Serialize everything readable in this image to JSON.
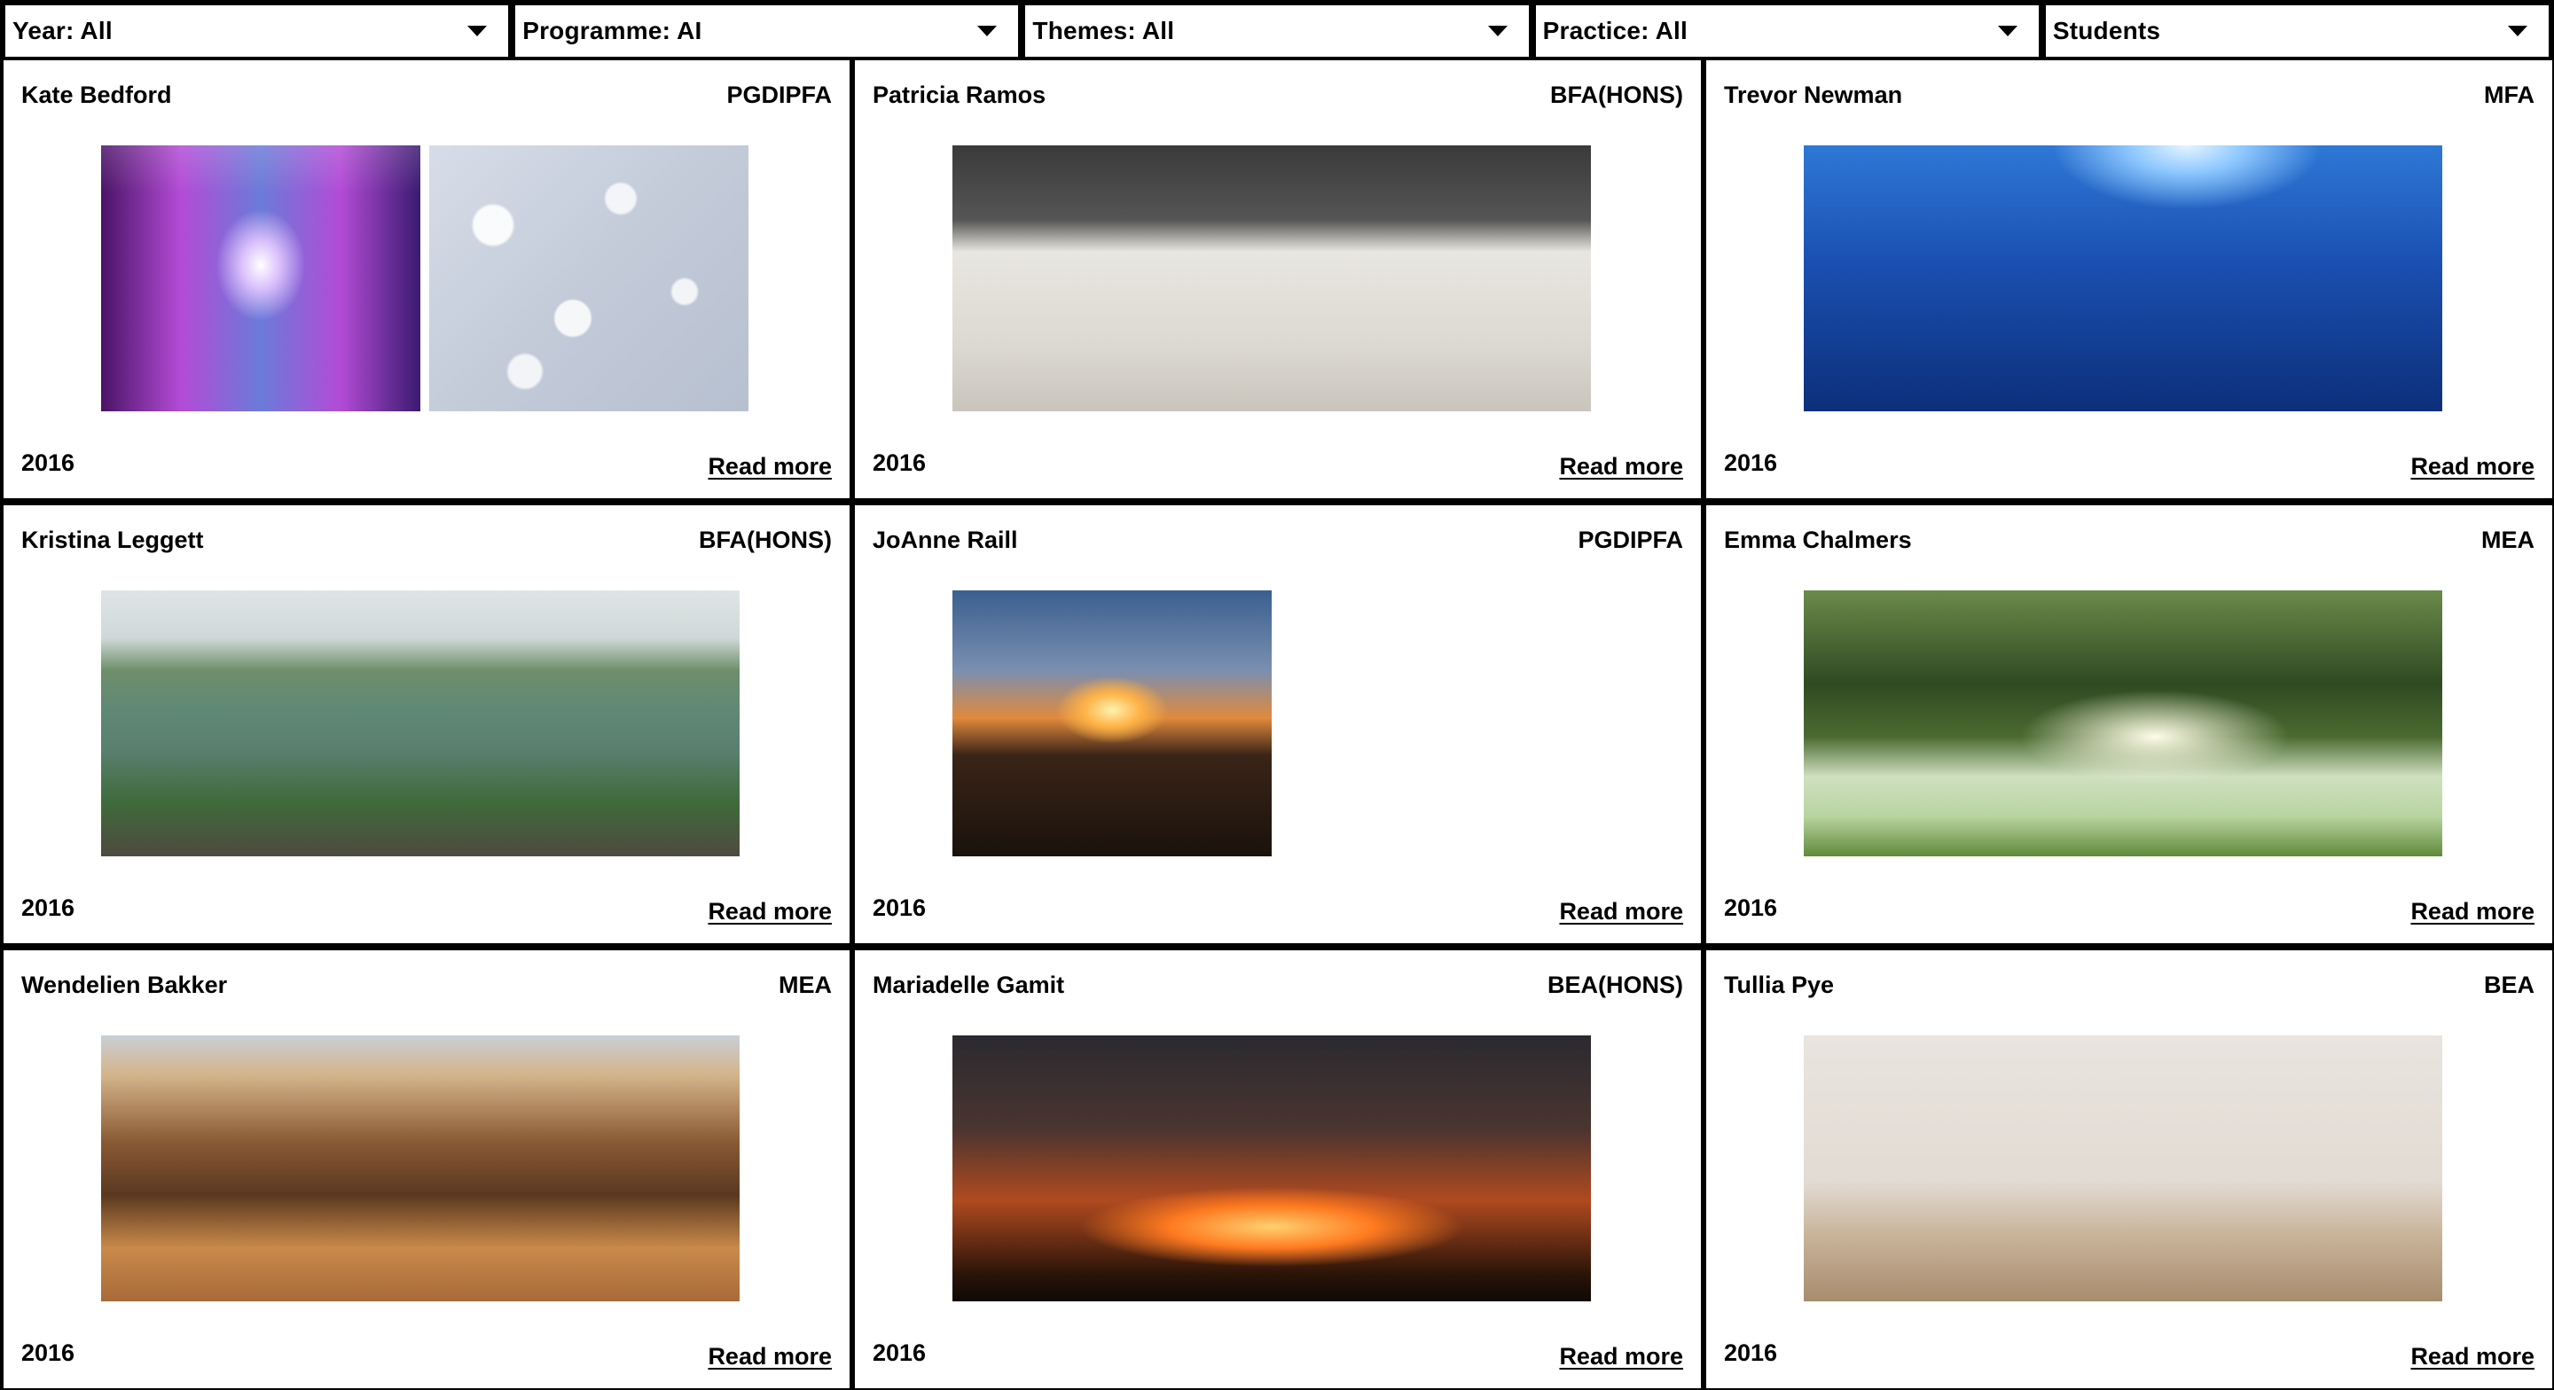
{
  "filters": [
    {
      "name": "filter-year",
      "label": "Year: All"
    },
    {
      "name": "filter-programme",
      "label": "Programme: AI"
    },
    {
      "name": "filter-themes",
      "label": "Themes: All"
    },
    {
      "name": "filter-practice",
      "label": "Practice: All"
    },
    {
      "name": "filter-students",
      "label": "Students"
    }
  ],
  "cards": [
    {
      "name": "Kate Bedford",
      "programme": "PGDIPFA",
      "year": "2016",
      "link": "Read more",
      "images": [
        "office",
        "drops"
      ]
    },
    {
      "name": "Patricia Ramos",
      "programme": "BFA(HONS)",
      "year": "2016",
      "link": "Read more",
      "images": [
        "snow"
      ]
    },
    {
      "name": "Trevor Newman",
      "programme": "MFA",
      "year": "2016",
      "link": "Read more",
      "images": [
        "ocean"
      ]
    },
    {
      "name": "Kristina Leggett",
      "programme": "BFA(HONS)",
      "year": "2016",
      "link": "Read more",
      "images": [
        "landscape"
      ]
    },
    {
      "name": "JoAnne Raill",
      "programme": "PGDIPFA",
      "year": "2016",
      "link": "Read more",
      "images": [
        "sunset"
      ]
    },
    {
      "name": "Emma Chalmers",
      "programme": "MEA",
      "year": "2016",
      "link": "Read more",
      "images": [
        "trees"
      ]
    },
    {
      "name": "Wendelien Bakker",
      "programme": "MEA",
      "year": "2016",
      "link": "Read more",
      "images": [
        "desert"
      ]
    },
    {
      "name": "Mariadelle Gamit",
      "programme": "BEA(HONS)",
      "year": "2016",
      "link": "Read more",
      "images": [
        "dusk"
      ]
    },
    {
      "name": "Tullia Pye",
      "programme": "BEA",
      "year": "2016",
      "link": "Read more",
      "images": [
        "interior"
      ]
    }
  ],
  "icons": {
    "dropdown": "caret-down-icon"
  }
}
